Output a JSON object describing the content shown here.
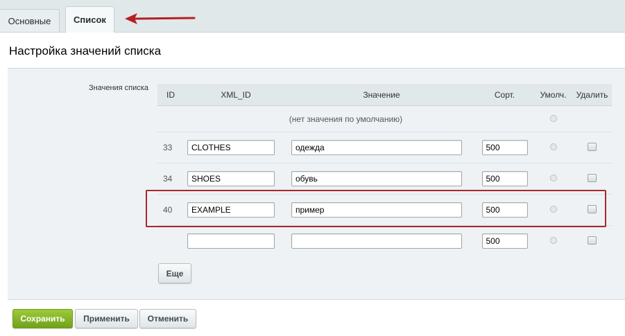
{
  "tabs": [
    {
      "label": "Основные"
    },
    {
      "label": "Список"
    }
  ],
  "section_title": "Настройка значений списка",
  "field_label": "Значения списка",
  "table": {
    "headers": {
      "id": "ID",
      "xml_id": "XML_ID",
      "value": "Значение",
      "sort": "Сорт.",
      "default": "Умолч.",
      "delete": "Удалить"
    },
    "no_default_text": "(нет значения по умолчанию)",
    "rows": [
      {
        "id": "33",
        "xml_id": "CLOTHES",
        "value": "одежда",
        "sort": "500"
      },
      {
        "id": "34",
        "xml_id": "SHOES",
        "value": "обувь",
        "sort": "500"
      },
      {
        "id": "40",
        "xml_id": "EXAMPLE",
        "value": "пример",
        "sort": "500"
      },
      {
        "id": "",
        "xml_id": "",
        "value": "",
        "sort": "500"
      }
    ]
  },
  "buttons": {
    "more": "Еще",
    "save": "Сохранить",
    "apply": "Применить",
    "cancel": "Отменить"
  },
  "colors": {
    "highlight_box": "#a8282c",
    "arrow": "#b51f25",
    "save_button": "#8dbb2f"
  }
}
